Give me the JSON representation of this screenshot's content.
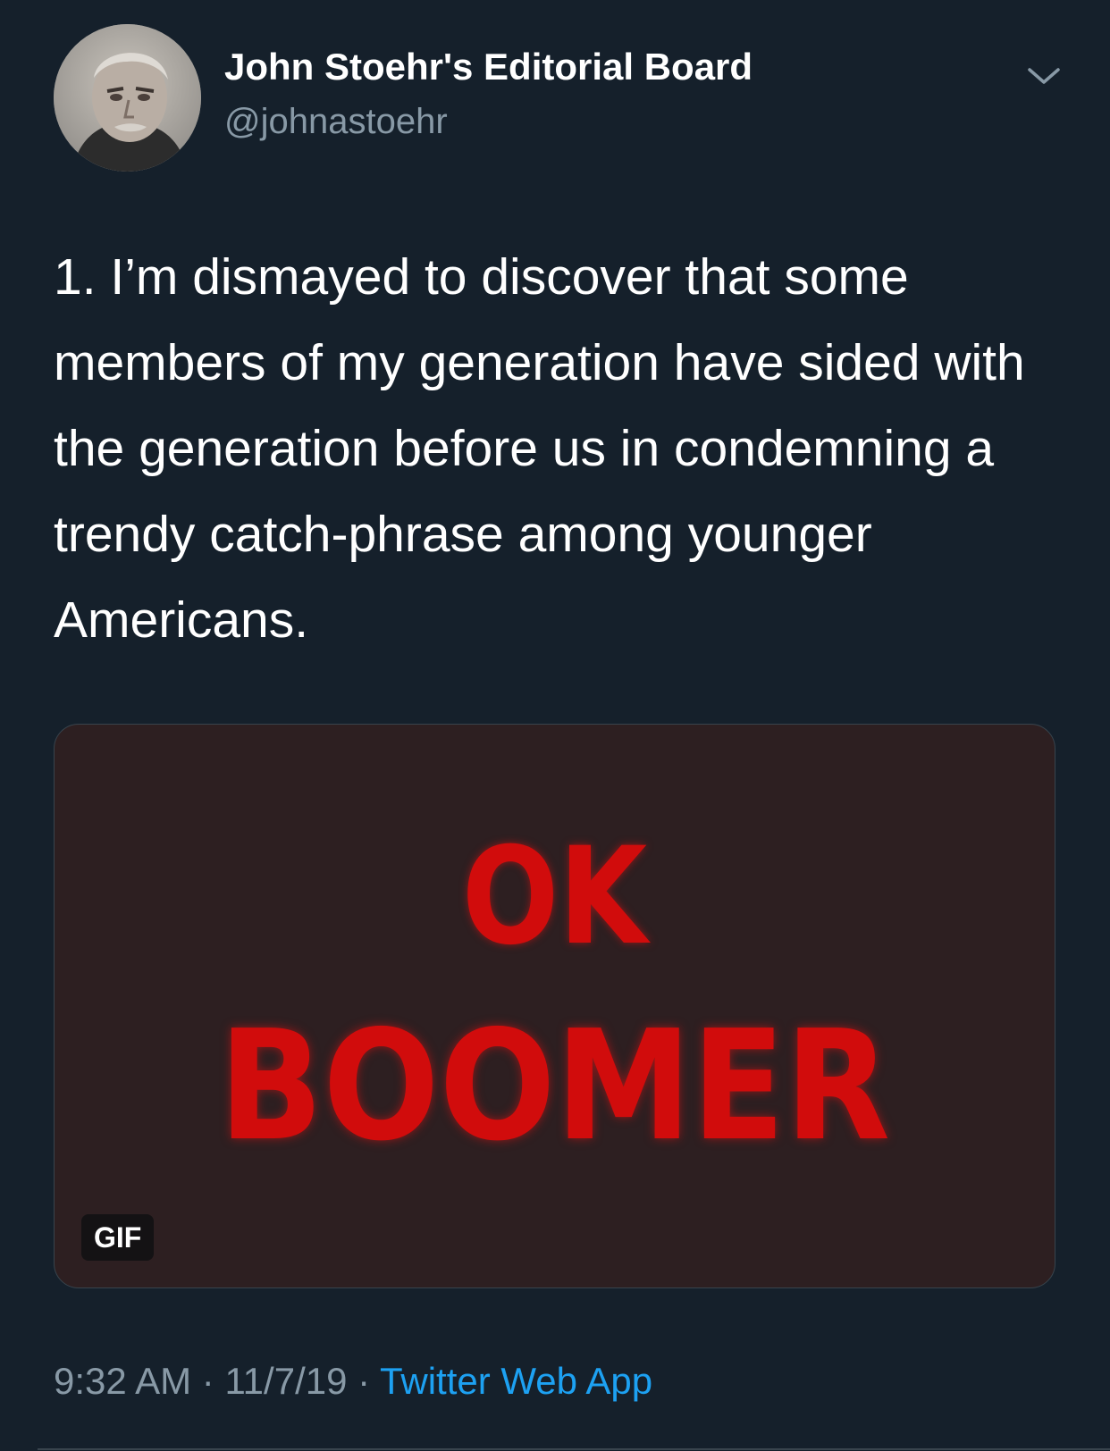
{
  "tweet": {
    "author": {
      "display_name": "John Stoehr's Editorial Board",
      "handle": "@johnastoehr",
      "avatar": "avatar-photo"
    },
    "menu_icon": "chevron-down-icon",
    "text": "1. I’m dismayed to discover that some members of my generation have sided with the generation before us in condemning a trendy catch-phrase among younger Americans.",
    "media": {
      "line1": "OK",
      "line2": "BOOMER",
      "badge": "GIF",
      "text_color": "#d10c0c",
      "background_color": "#2d1f21"
    },
    "meta": {
      "time": "9:32 AM",
      "separator": " · ",
      "date": "11/7/19",
      "source": "Twitter Web App"
    }
  },
  "colors": {
    "background": "#15202b",
    "secondary_text": "#8899a6",
    "link": "#1da1f2"
  }
}
